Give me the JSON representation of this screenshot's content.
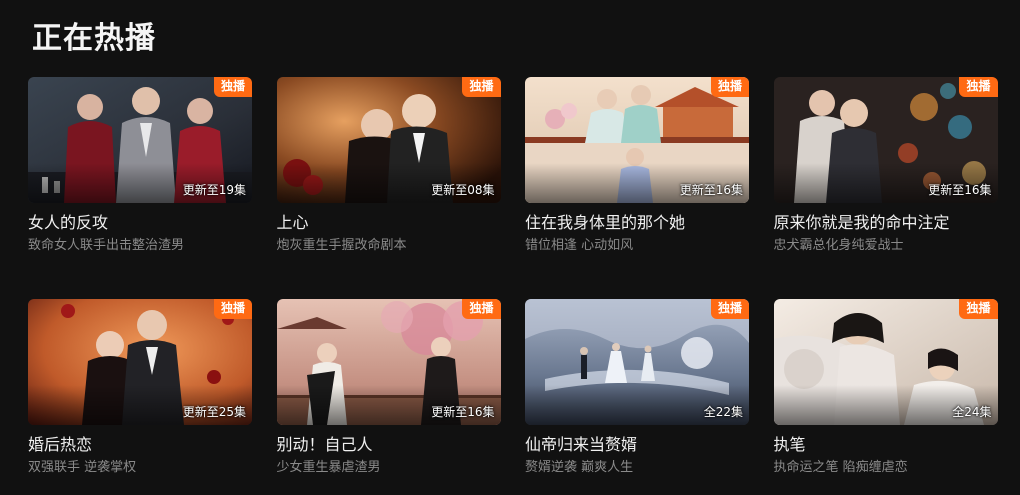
{
  "section": {
    "title": "正在热播"
  },
  "colors": {
    "accent": "#ff6a13",
    "background": "#111111",
    "subtitle": "#8a8a8a"
  },
  "cards": [
    {
      "title": "女人的反攻",
      "subtitle": "致命女人联手出击整治渣男",
      "badge": "独播",
      "episodes": "更新至19集"
    },
    {
      "title": "上心",
      "subtitle": "炮灰重生手握改命剧本",
      "badge": "独播",
      "episodes": "更新至08集"
    },
    {
      "title": "住在我身体里的那个她",
      "subtitle": "错位相逢 心动如风",
      "badge": "独播",
      "episodes": "更新至16集"
    },
    {
      "title": "原来你就是我的命中注定",
      "subtitle": "忠犬霸总化身纯爱战士",
      "badge": "独播",
      "episodes": "更新至16集"
    },
    {
      "title": "婚后热恋",
      "subtitle": "双强联手 逆袭掌权",
      "badge": "独播",
      "episodes": "更新至25集"
    },
    {
      "title": "别动！自己人",
      "subtitle": "少女重生暴虐渣男",
      "badge": "独播",
      "episodes": "更新至16集"
    },
    {
      "title": "仙帝归来当赘婿",
      "subtitle": "赘婿逆袭 巅爽人生",
      "badge": "独播",
      "episodes": "全22集"
    },
    {
      "title": "执笔",
      "subtitle": "执命运之笔 陷痴缠虐恋",
      "badge": "独播",
      "episodes": "全24集"
    }
  ]
}
